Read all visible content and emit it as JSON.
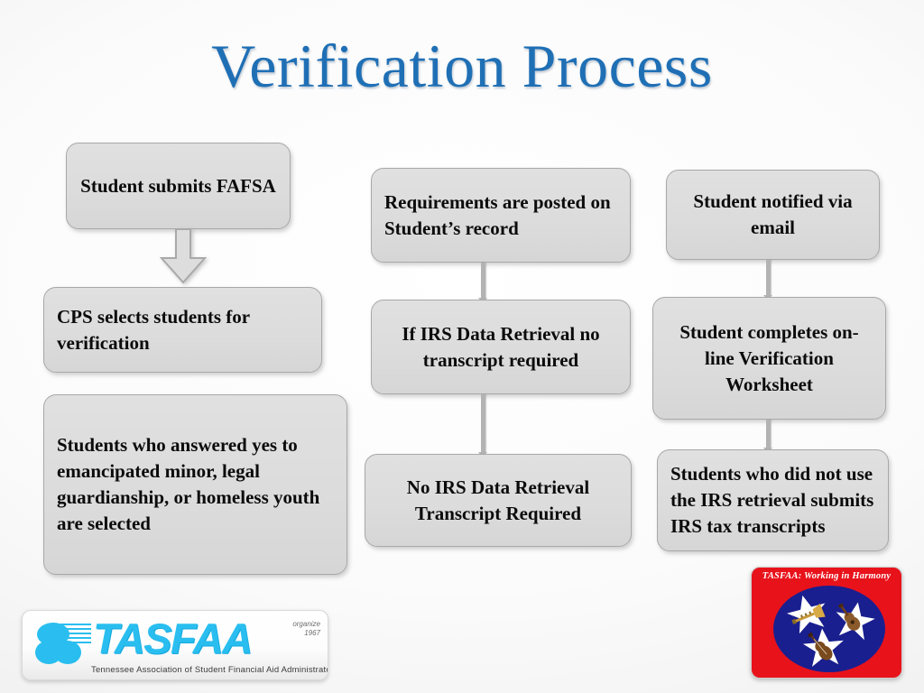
{
  "slide": {
    "title": "Verification Process",
    "title_color": "#1F6FB5",
    "background_color": "#f4f4f4"
  },
  "flow": {
    "columns": [
      {
        "name": "column-1",
        "boxes": [
          {
            "id": "student-submits-fafsa",
            "text": "Student submits FAFSA",
            "align": "center"
          },
          {
            "id": "cps-selects-students",
            "text": "CPS selects students for verification",
            "align": "left"
          },
          {
            "id": "students-answered-yes",
            "text": "Students who answered yes to emancipated minor, legal guardianship, or homeless youth are selected",
            "align": "left"
          }
        ]
      },
      {
        "name": "column-2",
        "boxes": [
          {
            "id": "requirements-posted",
            "text": "Requirements are posted on Student’s record",
            "align": "left"
          },
          {
            "id": "if-irs-data-retrieval",
            "text": "If IRS Data Retrieval no transcript required",
            "align": "center"
          },
          {
            "id": "no-irs-data-retrieval",
            "text": "No IRS Data Retrieval Transcript Required",
            "align": "center"
          }
        ]
      },
      {
        "name": "column-3",
        "boxes": [
          {
            "id": "student-notified-email",
            "text": "Student notified via email",
            "align": "center"
          },
          {
            "id": "student-completes-worksheet",
            "text": "Student completes on-line Verification Worksheet",
            "align": "center"
          },
          {
            "id": "students-did-not-use-irs",
            "text": "Students who did not use the IRS retrieval submits IRS tax transcripts",
            "align": "left"
          }
        ]
      }
    ],
    "box_fill_color": "#DCDCDC",
    "box_border_color": "#A8A8A8",
    "connector_color": "#B3B3B3"
  },
  "logos": {
    "tasfaa": {
      "name": "tasfaa-logo",
      "wordmark": "TASFAA",
      "organized_label": "organize",
      "organized_year": "1967",
      "tagline": "Tennessee Association of Student Financial Aid Administrators",
      "brand_color": "#29BEEF"
    },
    "harmony": {
      "name": "tasfaa-harmony-logo",
      "title": "TASFAA: Working in Harmony",
      "background_color": "#E8121B",
      "circle_color": "#1A1F8F",
      "star_color": "#FFFFFF",
      "icons": [
        "trumpet-icon",
        "guitar-icon",
        "fiddle-icon"
      ]
    }
  }
}
